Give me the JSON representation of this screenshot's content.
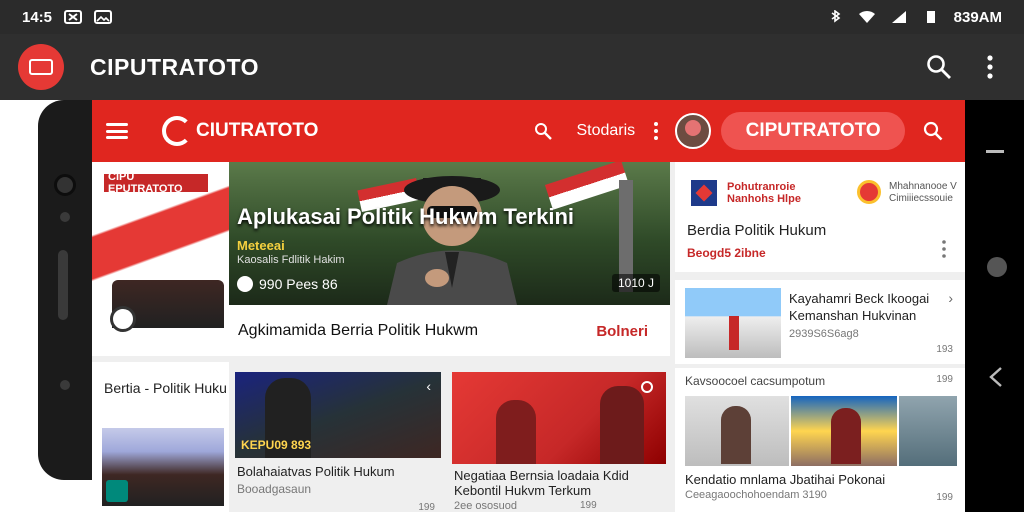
{
  "status_bar": {
    "time": "14:5",
    "right_text": "839AM",
    "icons": [
      "close-square-icon",
      "image-icon",
      "bluetooth-icon",
      "wifi-icon",
      "signal-icon",
      "battery-icon"
    ]
  },
  "app_bar": {
    "title": "CIPUTRATOTO",
    "icons": [
      "search-icon",
      "more-vert-icon"
    ]
  },
  "toolbar": {
    "brand": "CIUTRATOTO",
    "link": "Stodaris",
    "pill": "CIPUTRATOTO",
    "color": "#e0261f"
  },
  "hero": {
    "badge": "CIPU EPUTRATOTO",
    "title": "Aplukasai Politik Hukwm Terkini",
    "sub1": "Meteeai",
    "sub2": "Kaosalis Fdlitik Hakim",
    "meta": "990 Pees 86",
    "duration": "1010 J",
    "caption": "Agkimamida Berria Politik Hukwm",
    "link": "Bolneri"
  },
  "right_cards": {
    "top": {
      "a_line1": "Pohutranroie",
      "a_line2": "Nanhohs Hlpe",
      "b_line1": "Mhahnanooe V",
      "b_line2": "Cimiiiecssouie",
      "title": "Berdia Politik Hukum",
      "meta": "Beogd5 2ibne"
    },
    "mid": {
      "title": "Kayahamri Beck Ikoogai Kemanshan Hukvinan",
      "meta": "2939S6S6ag8",
      "duration": "193"
    },
    "bottom": {
      "head": "Kavsoocoel cacsumpotum",
      "head_duration": "199",
      "title": "Kendatio mnlama Jbatihai Pokonai",
      "meta": "Ceeagaoochohoendam 3190",
      "duration": "199"
    }
  },
  "bottom_row": {
    "section": {
      "label": "Bertia - Politik Huku"
    },
    "card1": {
      "overlay": "KEPU09 893",
      "title": "Bolahaiatvas Politik Hukum",
      "meta": "Booadgasaun",
      "duration": "199"
    },
    "card2": {
      "title": "Negatiaa Bernsia loadaia Kdid Kebontil Hukvm Terkum",
      "meta": "2ee ososuod",
      "duration": "199"
    }
  }
}
